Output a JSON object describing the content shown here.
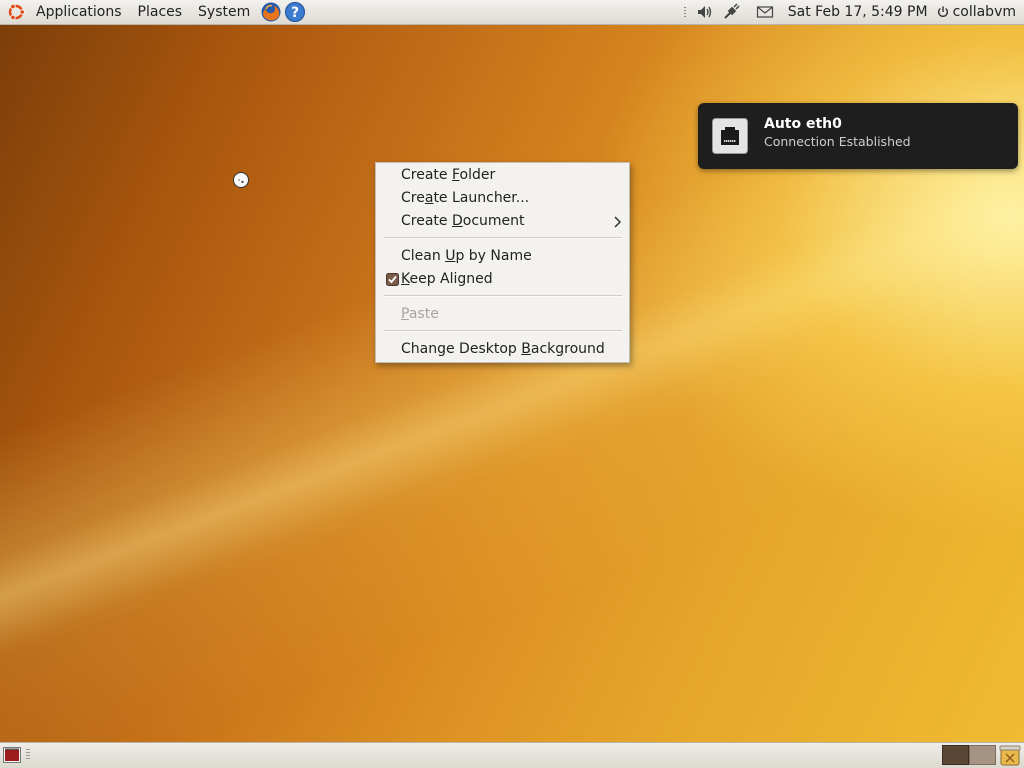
{
  "top_panel": {
    "menus": [
      "Applications",
      "Places",
      "System"
    ],
    "datetime": "Sat Feb 17,  5:49 PM",
    "username": "collabvm",
    "icons": [
      "ubuntu-logo-icon",
      "firefox-icon",
      "help-icon",
      "volume-icon",
      "network-icon",
      "mail-icon",
      "power-icon"
    ]
  },
  "context_menu": {
    "items": [
      {
        "label": "Create Folder",
        "mnemonic": "F",
        "enabled": true
      },
      {
        "label": "Create Launcher...",
        "mnemonic": "a",
        "enabled": true
      },
      {
        "label": "Create Document",
        "mnemonic": "D",
        "enabled": true,
        "submenu": true
      },
      {
        "label": "Clean Up by Name",
        "mnemonic": "U",
        "enabled": true
      },
      {
        "label": "Keep Aligned",
        "mnemonic": "K",
        "enabled": true,
        "checked": true
      },
      {
        "label": "Paste",
        "mnemonic": "P",
        "enabled": false
      },
      {
        "label": "Change Desktop Background",
        "mnemonic": "B",
        "enabled": true
      }
    ]
  },
  "notification": {
    "title": "Auto eth0",
    "body": "Connection Established",
    "icon": "ethernet-icon"
  },
  "bottom_panel": {
    "icons": [
      "show-desktop-icon",
      "workspace-switcher",
      "trash-icon"
    ]
  },
  "colors": {
    "panel": "#e6e4df",
    "wallpaper_dark": "#7a3d08",
    "wallpaper_light": "#f0bc32",
    "notification_bg": "#1e1e1e"
  }
}
